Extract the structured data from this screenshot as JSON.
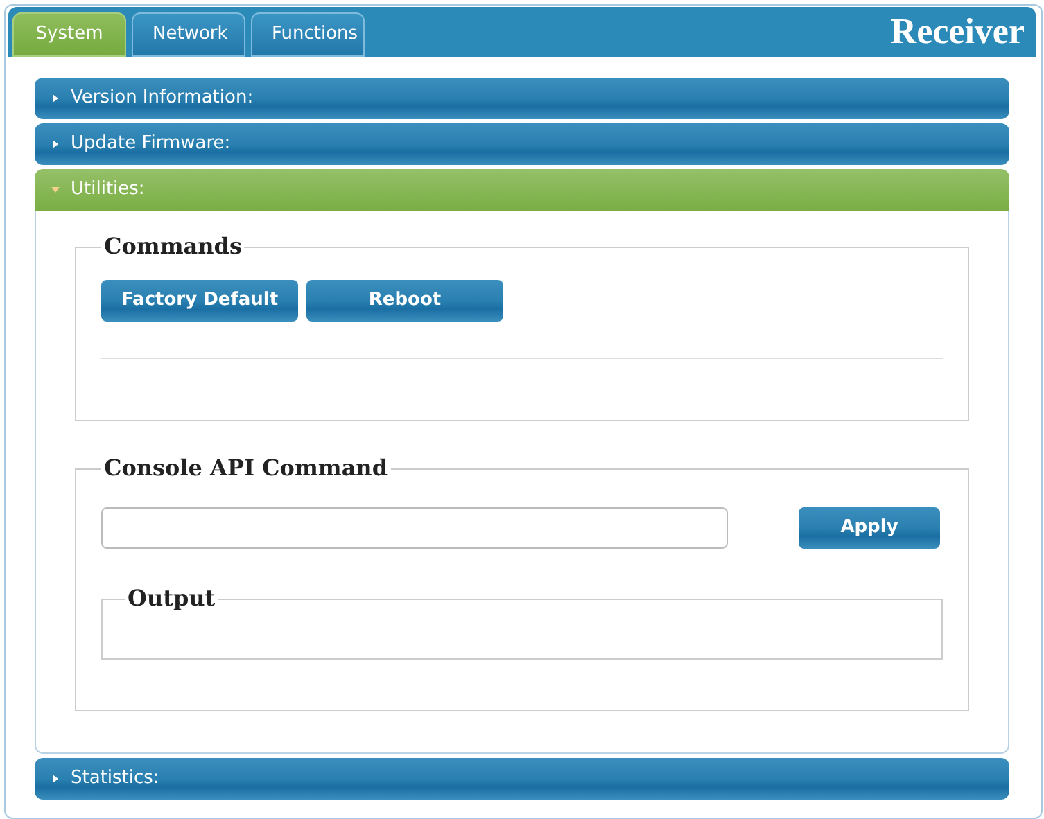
{
  "tabs": [
    {
      "label": "System",
      "selected": true
    },
    {
      "label": "Network",
      "selected": false
    },
    {
      "label": "Functions",
      "selected": false
    }
  ],
  "title": "Receiver",
  "sections": [
    {
      "title": "Version Information:",
      "expanded": false
    },
    {
      "title": "Update Firmware:",
      "expanded": false
    },
    {
      "title": "Utilities:",
      "expanded": true,
      "commands": {
        "legend": "Commands",
        "buttons": [
          "Factory Default",
          "Reboot"
        ]
      },
      "console": {
        "legend": "Console API Command",
        "button": "Apply",
        "output_legend": "Output"
      }
    },
    {
      "title": "Statistics:",
      "expanded": false
    }
  ]
}
